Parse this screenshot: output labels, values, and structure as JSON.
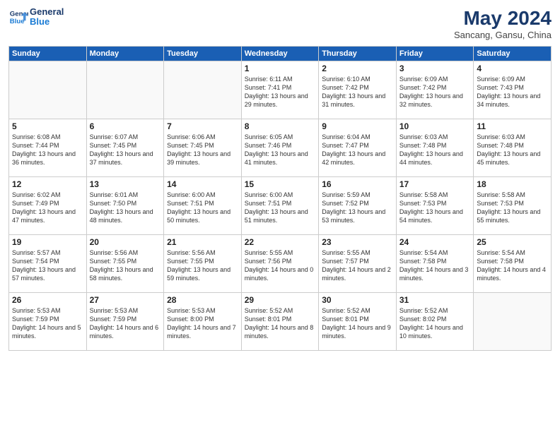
{
  "header": {
    "logo_line1": "General",
    "logo_line2": "Blue",
    "month_title": "May 2024",
    "subtitle": "Sancang, Gansu, China"
  },
  "weekdays": [
    "Sunday",
    "Monday",
    "Tuesday",
    "Wednesday",
    "Thursday",
    "Friday",
    "Saturday"
  ],
  "weeks": [
    [
      {
        "day": "",
        "info": ""
      },
      {
        "day": "",
        "info": ""
      },
      {
        "day": "",
        "info": ""
      },
      {
        "day": "1",
        "info": "Sunrise: 6:11 AM\nSunset: 7:41 PM\nDaylight: 13 hours\nand 29 minutes."
      },
      {
        "day": "2",
        "info": "Sunrise: 6:10 AM\nSunset: 7:42 PM\nDaylight: 13 hours\nand 31 minutes."
      },
      {
        "day": "3",
        "info": "Sunrise: 6:09 AM\nSunset: 7:42 PM\nDaylight: 13 hours\nand 32 minutes."
      },
      {
        "day": "4",
        "info": "Sunrise: 6:09 AM\nSunset: 7:43 PM\nDaylight: 13 hours\nand 34 minutes."
      }
    ],
    [
      {
        "day": "5",
        "info": "Sunrise: 6:08 AM\nSunset: 7:44 PM\nDaylight: 13 hours\nand 36 minutes."
      },
      {
        "day": "6",
        "info": "Sunrise: 6:07 AM\nSunset: 7:45 PM\nDaylight: 13 hours\nand 37 minutes."
      },
      {
        "day": "7",
        "info": "Sunrise: 6:06 AM\nSunset: 7:45 PM\nDaylight: 13 hours\nand 39 minutes."
      },
      {
        "day": "8",
        "info": "Sunrise: 6:05 AM\nSunset: 7:46 PM\nDaylight: 13 hours\nand 41 minutes."
      },
      {
        "day": "9",
        "info": "Sunrise: 6:04 AM\nSunset: 7:47 PM\nDaylight: 13 hours\nand 42 minutes."
      },
      {
        "day": "10",
        "info": "Sunrise: 6:03 AM\nSunset: 7:48 PM\nDaylight: 13 hours\nand 44 minutes."
      },
      {
        "day": "11",
        "info": "Sunrise: 6:03 AM\nSunset: 7:48 PM\nDaylight: 13 hours\nand 45 minutes."
      }
    ],
    [
      {
        "day": "12",
        "info": "Sunrise: 6:02 AM\nSunset: 7:49 PM\nDaylight: 13 hours\nand 47 minutes."
      },
      {
        "day": "13",
        "info": "Sunrise: 6:01 AM\nSunset: 7:50 PM\nDaylight: 13 hours\nand 48 minutes."
      },
      {
        "day": "14",
        "info": "Sunrise: 6:00 AM\nSunset: 7:51 PM\nDaylight: 13 hours\nand 50 minutes."
      },
      {
        "day": "15",
        "info": "Sunrise: 6:00 AM\nSunset: 7:51 PM\nDaylight: 13 hours\nand 51 minutes."
      },
      {
        "day": "16",
        "info": "Sunrise: 5:59 AM\nSunset: 7:52 PM\nDaylight: 13 hours\nand 53 minutes."
      },
      {
        "day": "17",
        "info": "Sunrise: 5:58 AM\nSunset: 7:53 PM\nDaylight: 13 hours\nand 54 minutes."
      },
      {
        "day": "18",
        "info": "Sunrise: 5:58 AM\nSunset: 7:53 PM\nDaylight: 13 hours\nand 55 minutes."
      }
    ],
    [
      {
        "day": "19",
        "info": "Sunrise: 5:57 AM\nSunset: 7:54 PM\nDaylight: 13 hours\nand 57 minutes."
      },
      {
        "day": "20",
        "info": "Sunrise: 5:56 AM\nSunset: 7:55 PM\nDaylight: 13 hours\nand 58 minutes."
      },
      {
        "day": "21",
        "info": "Sunrise: 5:56 AM\nSunset: 7:55 PM\nDaylight: 13 hours\nand 59 minutes."
      },
      {
        "day": "22",
        "info": "Sunrise: 5:55 AM\nSunset: 7:56 PM\nDaylight: 14 hours\nand 0 minutes."
      },
      {
        "day": "23",
        "info": "Sunrise: 5:55 AM\nSunset: 7:57 PM\nDaylight: 14 hours\nand 2 minutes."
      },
      {
        "day": "24",
        "info": "Sunrise: 5:54 AM\nSunset: 7:58 PM\nDaylight: 14 hours\nand 3 minutes."
      },
      {
        "day": "25",
        "info": "Sunrise: 5:54 AM\nSunset: 7:58 PM\nDaylight: 14 hours\nand 4 minutes."
      }
    ],
    [
      {
        "day": "26",
        "info": "Sunrise: 5:53 AM\nSunset: 7:59 PM\nDaylight: 14 hours\nand 5 minutes."
      },
      {
        "day": "27",
        "info": "Sunrise: 5:53 AM\nSunset: 7:59 PM\nDaylight: 14 hours\nand 6 minutes."
      },
      {
        "day": "28",
        "info": "Sunrise: 5:53 AM\nSunset: 8:00 PM\nDaylight: 14 hours\nand 7 minutes."
      },
      {
        "day": "29",
        "info": "Sunrise: 5:52 AM\nSunset: 8:01 PM\nDaylight: 14 hours\nand 8 minutes."
      },
      {
        "day": "30",
        "info": "Sunrise: 5:52 AM\nSunset: 8:01 PM\nDaylight: 14 hours\nand 9 minutes."
      },
      {
        "day": "31",
        "info": "Sunrise: 5:52 AM\nSunset: 8:02 PM\nDaylight: 14 hours\nand 10 minutes."
      },
      {
        "day": "",
        "info": ""
      }
    ]
  ]
}
